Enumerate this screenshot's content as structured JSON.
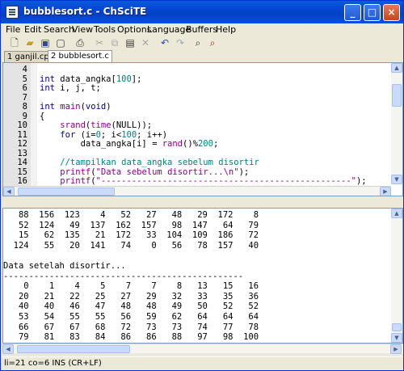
{
  "window": {
    "title": "bubblesort.c - ChSciTE"
  },
  "menu": [
    "File",
    "Edit",
    "Search",
    "View",
    "Tools",
    "Options",
    "Language",
    "Buffers",
    "Help"
  ],
  "tabs": [
    {
      "label": "1 ganjil.cpp"
    },
    {
      "label": "2 bubblesort.c"
    }
  ],
  "editor": {
    "lines": [
      {
        "n": "4",
        "code": ""
      },
      {
        "n": "5",
        "code": "int data_angka[100];"
      },
      {
        "n": "6",
        "code": "int i, j, t;"
      },
      {
        "n": "7",
        "code": ""
      },
      {
        "n": "8",
        "code": "int main(void)"
      },
      {
        "n": "9",
        "code": "{"
      },
      {
        "n": "10",
        "code": "    srand(time(NULL));"
      },
      {
        "n": "11",
        "code": "    for (i=0; i<100; i++)"
      },
      {
        "n": "12",
        "code": "        data_angka[i] = rand()%200;"
      },
      {
        "n": "13",
        "code": ""
      },
      {
        "n": "14",
        "code": "    //tampilkan data_angka sebelum disortir"
      },
      {
        "n": "15",
        "code": "    printf(\"Data sebelum disortir...\\n\");"
      },
      {
        "n": "16",
        "code": "    printf(\"-------------------------------------------------\");"
      }
    ]
  },
  "output": {
    "lines": [
      "   88  156  123    4   52   27   48   29  172    8",
      "   52  124   49  137  162  157   98  147   64   79",
      "   15   62  135   21  172   33  104  109  186   72",
      "  124   55   20  141   74    0   56   78  157   40",
      "",
      "Data setelah disortir...",
      "-----------------------------------------------",
      "    0    1    4    5    7    7    8   13   15   16",
      "   20   21   22   25   27   29   32   33   35   36",
      "   40   40   46   47   48   48   49   50   52   52",
      "   53   54   55   55   56   59   62   64   64   64",
      "   66   67   67   68   72   73   73   74   77   78",
      "   79   81   83   84   86   86   88   97   98  100"
    ]
  },
  "status": {
    "text": "li=21 co=6 INS (CR+LF)"
  },
  "icons": {
    "new": "new-file-icon",
    "open": "open-folder-icon",
    "save": "save-icon",
    "close": "close-file-icon",
    "print": "print-icon",
    "cut": "cut-icon",
    "copy": "copy-icon",
    "paste": "paste-icon",
    "delete": "delete-icon",
    "undo": "undo-icon",
    "redo": "redo-icon",
    "find": "find-icon",
    "replace": "replace-icon"
  },
  "colors": {
    "keyword": "#00007f",
    "string": "#7f007f",
    "comment": "#007f7f",
    "title_bar": "#0349d4"
  }
}
